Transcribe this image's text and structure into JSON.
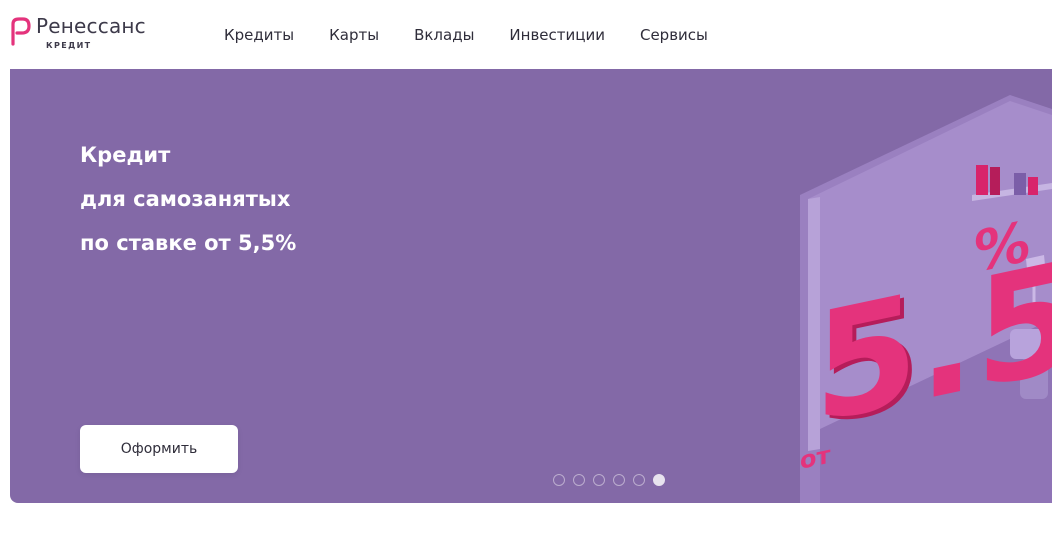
{
  "logo": {
    "name": "Ренессанс",
    "sub": "КРЕДИТ",
    "accent": "#e4337c"
  },
  "nav": {
    "items": [
      {
        "label": "Кредиты"
      },
      {
        "label": "Карты"
      },
      {
        "label": "Вклады"
      },
      {
        "label": "Инвестиции"
      },
      {
        "label": "Сервисы"
      }
    ]
  },
  "banner": {
    "background": "#8369a7",
    "headline": [
      "Кредит",
      "для самозанятых",
      "по ставке от 5,5%"
    ],
    "cta_label": "Оформить",
    "illustration": {
      "number": "5.5",
      "percent": "%",
      "prefix": "от"
    },
    "slides_total": 6,
    "active_slide": 6
  }
}
